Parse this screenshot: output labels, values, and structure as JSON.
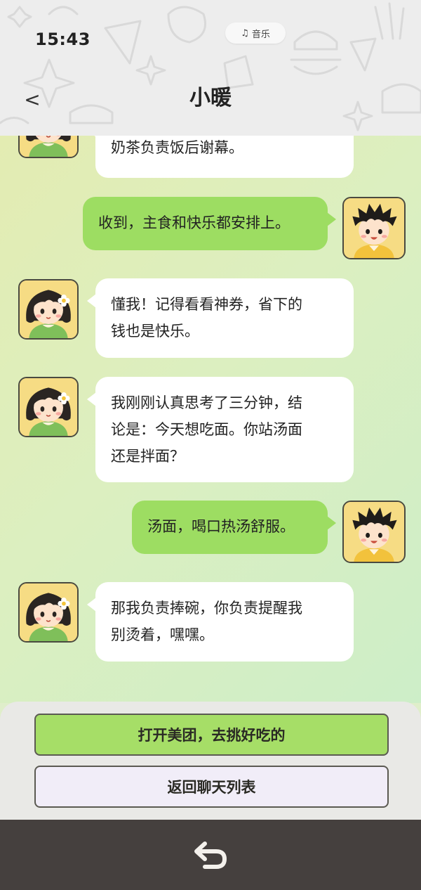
{
  "status": {
    "time": "15:43"
  },
  "music": {
    "label": "音乐",
    "icon": "music-note-icon",
    "glyph": "♫"
  },
  "header": {
    "title": "小暖",
    "back_glyph": "<"
  },
  "messages": [
    {
      "side": "left",
      "avatar": "girl-avatar",
      "text": "奶茶负责饭后谢幕。"
    },
    {
      "side": "right",
      "avatar": "boy-avatar",
      "text": "收到，主食和快乐都安排上。"
    },
    {
      "side": "left",
      "avatar": "girl-avatar",
      "line1": "懂我！记得看看神券，省下的",
      "line2": "钱也是快乐。"
    },
    {
      "side": "left",
      "avatar": "girl-avatar",
      "line1": "我刚刚认真思考了三分钟，结",
      "line2": "论是：今天想吃面。你站汤面",
      "line3": "还是拌面？"
    },
    {
      "side": "right",
      "avatar": "boy-avatar",
      "text": "汤面，喝口热汤舒服。"
    },
    {
      "side": "left",
      "avatar": "girl-avatar",
      "line1": "那我负责捧碗，你负责提醒我",
      "line2": "别烫着，嘿嘿。"
    }
  ],
  "actions": {
    "primary": "打开美团，去挑好吃的",
    "secondary": "返回聊天列表"
  },
  "nav": {
    "back_icon": "return-arrow-icon"
  },
  "colors": {
    "header_bg": "#ededed",
    "left_bubble": "#ffffff",
    "right_bubble": "#9ddd62",
    "primary_button": "#a6de67",
    "secondary_button": "#f1edf8",
    "bottom_bar": "#45403e"
  }
}
